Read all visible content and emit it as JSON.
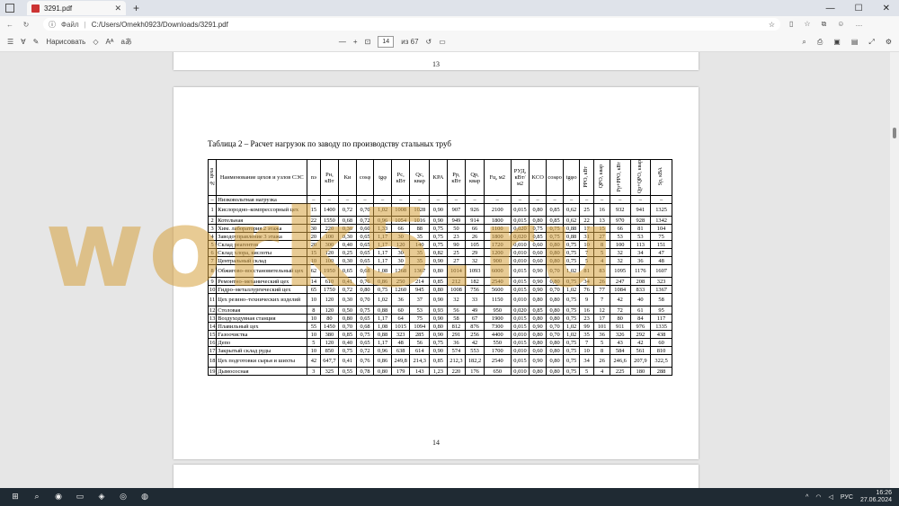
{
  "browser": {
    "tab_title": "3291.pdf",
    "file_label": "Файл",
    "url": "C:/Users/Omekh0923/Downloads/3291.pdf"
  },
  "pdf_toolbar": {
    "draw_label": "Нарисовать",
    "page_current": "14",
    "page_total": "из 67"
  },
  "document": {
    "prev_page_number": "13",
    "page_number": "14",
    "caption": "Таблица 2 – Расчет нагрузок по заводу по производству стальных труб",
    "headers": [
      "№ цеха",
      "Наименование цехов и узлов СЭС",
      "nэ",
      "Pн, кВт",
      "Kи",
      "cosφ",
      "tgφ",
      "Pс, кВт",
      "Qс, квар",
      "KРА",
      "Pр, кВт",
      "Qр, квар",
      "Fц, м2",
      "PУД, кВт/м2",
      "KCO",
      "cosφо",
      "tgφо",
      "PРО, кВт",
      "QРО, квар",
      "Pр+PРО, кВт",
      "Qр+QРО, квар",
      "Sр, кВА"
    ],
    "rows": [
      [
        "–",
        "Низковольтная нагрузка",
        "–",
        "–",
        "–",
        "–",
        "–",
        "–",
        "–",
        "–",
        "–",
        "–",
        "–",
        "–",
        "–",
        "–",
        "–",
        "–",
        "–",
        "–",
        "–",
        "–"
      ],
      [
        "1",
        "Кислородно–компрессорный цех",
        "15",
        "1400",
        "0,72",
        "0,70",
        "1,02",
        "1008",
        "1028",
        "0,90",
        "907",
        "926",
        "2100",
        "0,015",
        "0,80",
        "0,85",
        "0,62",
        "25",
        "16",
        "932",
        "941",
        "1325"
      ],
      [
        "2",
        "Котельная",
        "22",
        "1550",
        "0,68",
        "0,72",
        "0,96",
        "1054",
        "1016",
        "0,90",
        "949",
        "914",
        "1800",
        "0,015",
        "0,80",
        "0,85",
        "0,62",
        "22",
        "13",
        "970",
        "928",
        "1342"
      ],
      [
        "3",
        "Хим. лаборатория 2 этажа",
        "30",
        "220",
        "0,30",
        "0,60",
        "1,33",
        "66",
        "88",
        "0,75",
        "50",
        "66",
        "1100",
        "0,020",
        "0,75",
        "0,75",
        "0,88",
        "17",
        "15",
        "66",
        "81",
        "104"
      ],
      [
        "4",
        "Заводоуправление 3 этажа",
        "20",
        "100",
        "0,30",
        "0,65",
        "1,17",
        "30",
        "35",
        "0,75",
        "23",
        "26",
        "1800",
        "0,020",
        "0,85",
        "0,75",
        "0,88",
        "31",
        "27",
        "53",
        "53",
        "75"
      ],
      [
        "5",
        "Склад реагентов",
        "20",
        "300",
        "0,40",
        "0,65",
        "1,17",
        "120",
        "140",
        "0,75",
        "90",
        "105",
        "1720",
        "0,010",
        "0,60",
        "0,80",
        "0,75",
        "10",
        "8",
        "100",
        "113",
        "151"
      ],
      [
        "6",
        "Склад хлора, кислоты",
        "15",
        "120",
        "0,25",
        "0,65",
        "1,17",
        "30",
        "35",
        "0,82",
        "25",
        "29",
        "1200",
        "0,010",
        "0,60",
        "0,80",
        "0,75",
        "7",
        "5",
        "32",
        "34",
        "47"
      ],
      [
        "7",
        "Центральный склад",
        "10",
        "100",
        "0,30",
        "0,65",
        "1,17",
        "30",
        "35",
        "0,90",
        "27",
        "32",
        "900",
        "0,010",
        "0,60",
        "0,80",
        "0,75",
        "5",
        "4",
        "32",
        "36",
        "48"
      ],
      [
        "8",
        "Обжигово–восстановительный цех",
        "62",
        "1950",
        "0,65",
        "0,68",
        "1,08",
        "1268",
        "1367",
        "0,80",
        "1014",
        "1093",
        "6000",
        "0,015",
        "0,90",
        "0,70",
        "1,02",
        "81",
        "83",
        "1095",
        "1176",
        "1607"
      ],
      [
        "9",
        "Ремонтно–механический цех",
        "14",
        "610",
        "0,41",
        "0,76",
        "0,86",
        "250",
        "214",
        "0,85",
        "212",
        "182",
        "2540",
        "0,015",
        "0,90",
        "0,80",
        "0,75",
        "34",
        "26",
        "247",
        "208",
        "323"
      ],
      [
        "10",
        "Гидро–металлургический цех",
        "65",
        "1750",
        "0,72",
        "0,80",
        "0,75",
        "1260",
        "945",
        "0,80",
        "1008",
        "756",
        "5600",
        "0,015",
        "0,90",
        "0,70",
        "1,02",
        "76",
        "77",
        "1084",
        "833",
        "1367"
      ],
      [
        "11",
        "Цех резино–технических изделий",
        "10",
        "120",
        "0,30",
        "0,70",
        "1,02",
        "36",
        "37",
        "0,90",
        "32",
        "33",
        "1150",
        "0,010",
        "0,80",
        "0,80",
        "0,75",
        "9",
        "7",
        "42",
        "40",
        "58"
      ],
      [
        "12",
        "Столовая",
        "8",
        "120",
        "0,50",
        "0,75",
        "0,88",
        "60",
        "53",
        "0,93",
        "56",
        "49",
        "950",
        "0,020",
        "0,85",
        "0,80",
        "0,75",
        "16",
        "12",
        "72",
        "61",
        "95"
      ],
      [
        "13",
        "Воздуходувная станция",
        "10",
        "80",
        "0,80",
        "0,65",
        "1,17",
        "64",
        "75",
        "0,90",
        "58",
        "67",
        "1900",
        "0,015",
        "0,80",
        "0,80",
        "0,75",
        "23",
        "17",
        "80",
        "84",
        "117"
      ],
      [
        "14",
        "Плавильный цех",
        "55",
        "1450",
        "0,70",
        "0,68",
        "1,08",
        "1015",
        "1094",
        "0,80",
        "812",
        "876",
        "7300",
        "0,015",
        "0,90",
        "0,70",
        "1,02",
        "99",
        "101",
        "911",
        "976",
        "1335"
      ],
      [
        "15",
        "Газоочистка",
        "10",
        "380",
        "0,85",
        "0,75",
        "0,88",
        "323",
        "285",
        "0,90",
        "291",
        "256",
        "4400",
        "0,010",
        "0,80",
        "0,70",
        "1,02",
        "35",
        "36",
        "326",
        "292",
        "438"
      ],
      [
        "16",
        "Депо",
        "5",
        "120",
        "0,40",
        "0,65",
        "1,17",
        "48",
        "56",
        "0,75",
        "36",
        "42",
        "550",
        "0,015",
        "0,80",
        "0,80",
        "0,75",
        "7",
        "5",
        "43",
        "42",
        "60"
      ],
      [
        "17",
        "Закрытый склад руды",
        "10",
        "850",
        "0,75",
        "0,72",
        "0,96",
        "638",
        "614",
        "0,90",
        "574",
        "553",
        "1700",
        "0,010",
        "0,60",
        "0,80",
        "0,75",
        "10",
        "8",
        "584",
        "561",
        "810"
      ],
      [
        "18",
        "Цех подготовки сырья и шихты",
        "42",
        "647,7",
        "0,41",
        "0,76",
        "0,86",
        "249,8",
        "214,3",
        "0,85",
        "212,3",
        "182,2",
        "2540",
        "0,015",
        "0,90",
        "0,80",
        "0,75",
        "34",
        "26",
        "246,6",
        "207,9",
        "322,5"
      ],
      [
        "19",
        "Дымососная",
        "3",
        "325",
        "0,55",
        "0,78",
        "0,80",
        "179",
        "143",
        "1,23",
        "220",
        "176",
        "650",
        "0,010",
        "0,80",
        "0,80",
        "0,75",
        "5",
        "4",
        "225",
        "180",
        "288"
      ]
    ],
    "watermark": "work5.ru"
  },
  "taskbar": {
    "lang": "РУС",
    "time": "16:26",
    "date": "27.06.2024"
  }
}
